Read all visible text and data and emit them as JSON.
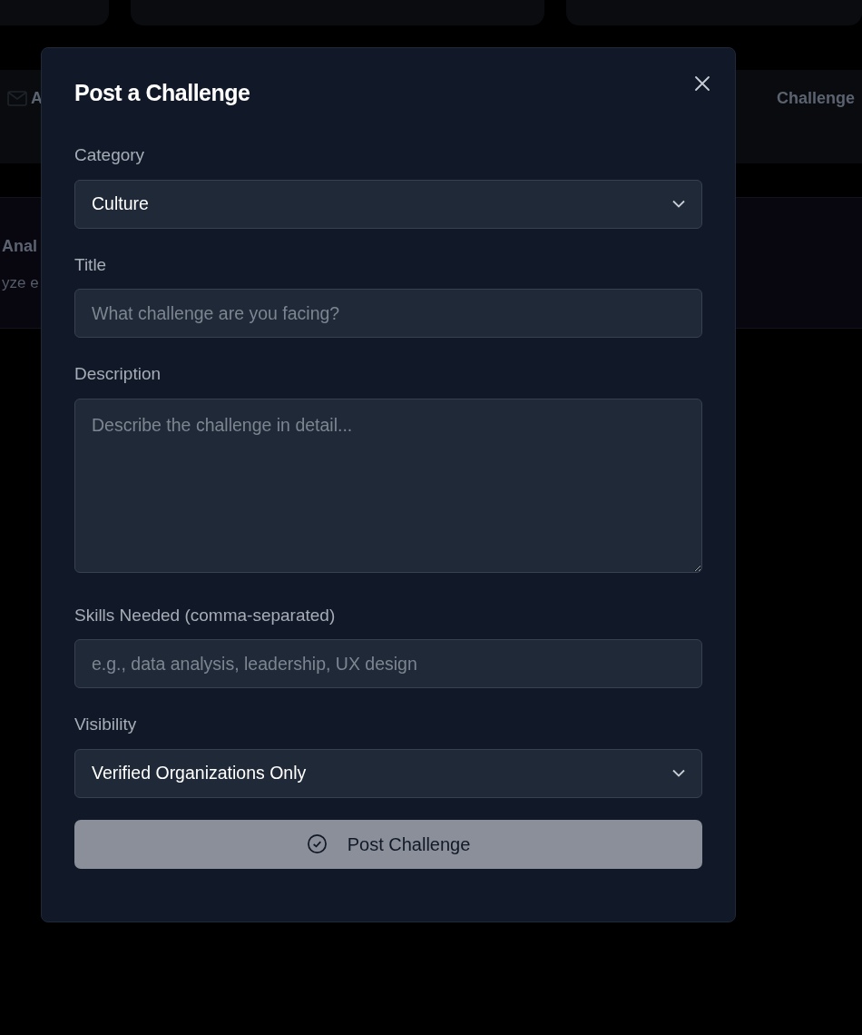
{
  "background": {
    "tabs": [
      {
        "kind": "mail",
        "label": "A"
      },
      {
        "kind": "plain",
        "label": "Challenge"
      }
    ],
    "panel": {
      "title": "Anal",
      "text": "yze e"
    }
  },
  "dialog": {
    "title": "Post a Challenge",
    "fields": [
      {
        "kind": "select",
        "label": "Category",
        "value": "Culture"
      },
      {
        "kind": "text",
        "label": "Title",
        "placeholder": "What challenge are you facing?"
      },
      {
        "kind": "textarea",
        "label": "Description",
        "placeholder": "Describe the challenge in detail..."
      },
      {
        "kind": "text",
        "label": "Skills Needed (comma-separated)",
        "placeholder": "e.g., data analysis, leadership, UX design"
      },
      {
        "kind": "select",
        "label": "Visibility",
        "value": "Verified Organizations Only"
      }
    ],
    "submit": {
      "label": "Post Challenge",
      "disabled": true
    }
  }
}
